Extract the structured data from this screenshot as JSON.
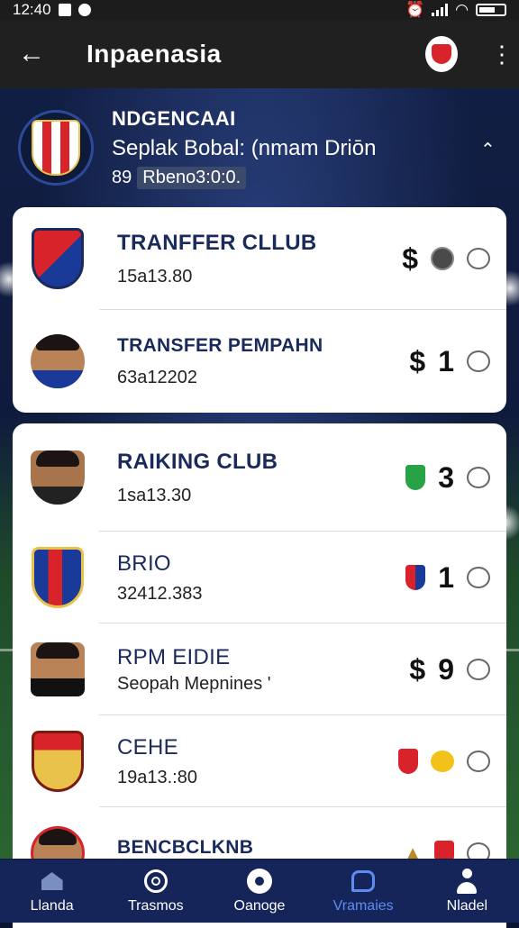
{
  "status_bar": {
    "time": "12:40",
    "icons": [
      "image-icon",
      "chat-icon",
      "alarm-icon",
      "signal-icon",
      "wifi-icon",
      "battery-icon"
    ]
  },
  "app_bar": {
    "title": "Inpaenasia",
    "back_icon": "arrow-left-icon",
    "menu_icon": "more-vert-icon"
  },
  "header": {
    "name": "NDGENCAAI",
    "subtitle": "Seplak Bobal: (nmam Driōn",
    "meta_number": "89",
    "meta_pill": "Rbeno3:0:0."
  },
  "list_groups": [
    {
      "rows": [
        {
          "title": "TRANFFER CLLUB",
          "sub": "15a13.80",
          "avatar": "club-crest",
          "crest_colors": [
            "#d8232a",
            "#1a3a9a"
          ],
          "marker": "$",
          "badge": "coin",
          "count": ""
        },
        {
          "title": "TRANSFER PEMPAHN",
          "sub": "63a12202",
          "avatar": "player-photo",
          "shirt_color": "#1a3a9a",
          "marker": "$",
          "badge": "",
          "count": "1"
        }
      ]
    },
    {
      "rows": [
        {
          "title": "RAIKING CLUB",
          "sub": "1sa13.30",
          "avatar": "player-photo",
          "shirt_color": "#222222",
          "marker": "",
          "badge": "green-shield",
          "count": "3"
        },
        {
          "title": "BRIO",
          "sub": "32412.383",
          "avatar": "club-crest",
          "crest_colors": [
            "#1a3a9a",
            "#e8c24a"
          ],
          "marker": "",
          "badge": "red-blue-shield",
          "count": "1"
        },
        {
          "title": "RPM EIDIE",
          "sub": "Seopah Mepnines '",
          "avatar": "player-photo",
          "shirt_color": "#111111",
          "marker": "$",
          "badge": "",
          "count": "9"
        },
        {
          "title": "CEHE",
          "sub": "19a13.:80",
          "avatar": "club-crest",
          "crest_colors": [
            "#d8232a",
            "#e8c24a"
          ],
          "marker": "",
          "badge": "red-shield+yellow-badge",
          "count": ""
        },
        {
          "title": "BENCBCLKNB",
          "sub": "",
          "avatar": "player-photo",
          "shirt_color": "#d8232a",
          "marker": "",
          "badge": "trophy+red-shield",
          "count": ""
        }
      ]
    }
  ],
  "bottom_nav": [
    {
      "label": "Llanda",
      "icon": "home-icon",
      "active": false
    },
    {
      "label": "Trasmos",
      "icon": "target-icon",
      "active": false
    },
    {
      "label": "Oanoge",
      "icon": "football-icon",
      "active": false
    },
    {
      "label": "Vramaies",
      "icon": "chat-bubble-icon",
      "active": true
    },
    {
      "label": "Nladel",
      "icon": "person-icon",
      "active": false
    }
  ],
  "colors": {
    "accent": "#5b8ef0",
    "nav_bg": "#15255a",
    "title_navy": "#1a2a5a"
  }
}
